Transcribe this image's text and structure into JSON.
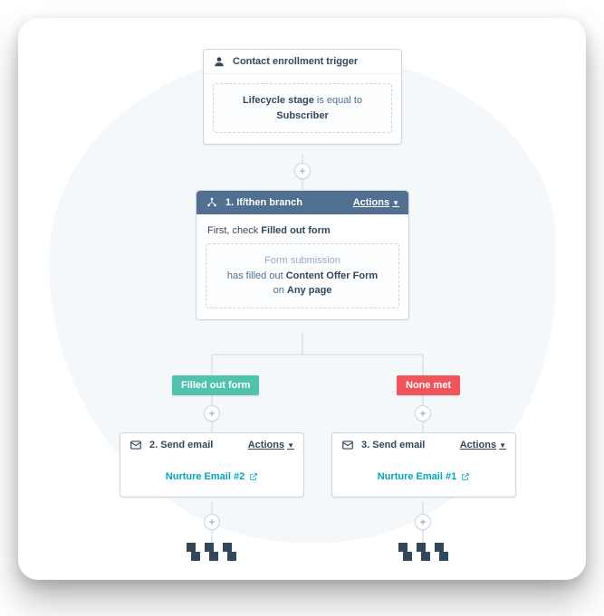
{
  "trigger": {
    "title": "Contact enrollment trigger",
    "rule_field": "Lifecycle stage",
    "rule_op": "is equal to",
    "rule_value": "Subscriber"
  },
  "branch": {
    "number_label": "1. If/then branch",
    "actions_label": "Actions",
    "first_check_prefix": "First, check ",
    "first_check_value": "Filled out form",
    "cond_line1": "Form submission",
    "cond_line2_prefix": "has filled out ",
    "cond_line2_value": "Content Offer Form",
    "cond_line3_prefix": "on ",
    "cond_line3_value": "Any page"
  },
  "tags": {
    "yes": "Filled out form",
    "no": "None met"
  },
  "email_left": {
    "header": "2. Send email",
    "actions_label": "Actions",
    "link": "Nurture Email #2"
  },
  "email_right": {
    "header": "3. Send email",
    "actions_label": "Actions",
    "link": "Nurture Email #1"
  },
  "plus_glyph": "+"
}
